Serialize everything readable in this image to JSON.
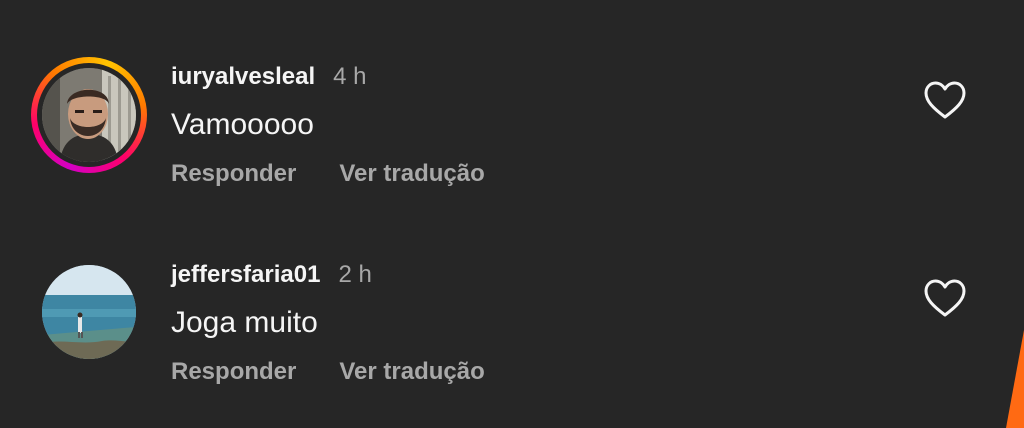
{
  "comments": [
    {
      "username": "iuryalvesleal",
      "time": "4 h",
      "text": "Vamooooo",
      "reply_label": "Responder",
      "translate_label": "Ver tradução",
      "has_story_ring": true
    },
    {
      "username": "jeffersfaria01",
      "time": "2 h",
      "text": "Joga muito",
      "reply_label": "Responder",
      "translate_label": "Ver tradução",
      "has_story_ring": false
    }
  ],
  "icons": {
    "like": "heart-outline-icon"
  },
  "colors": {
    "background": "#262626",
    "primary_text": "#f5f5f5",
    "secondary_text": "#a8a8a8",
    "story_ring_start": "#d300c5",
    "story_ring_end": "#ffc400",
    "edge_accent": "#ff6a13"
  }
}
